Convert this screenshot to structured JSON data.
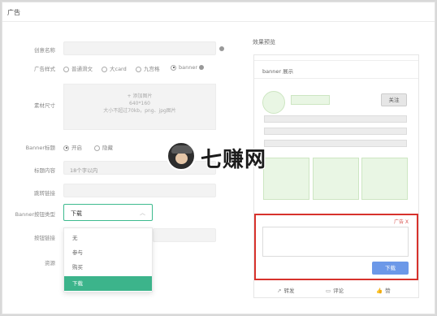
{
  "window": {
    "title": "广告"
  },
  "form": {
    "creative_name_label": "创意名称",
    "ad_style_label": "广告样式",
    "ad_style_options": [
      "普通滑文",
      "大card",
      "九宫格",
      "banner"
    ],
    "ad_style_selected": "banner",
    "material_size_label": "素材尺寸",
    "upload_add": "+ 添加图片",
    "upload_size": "640*160",
    "upload_hint": "大小不超过70kb，png、jpg图片",
    "banner_title_label": "Banner标题",
    "banner_title_options": [
      "开启",
      "隐藏"
    ],
    "banner_title_selected": "开启",
    "title_content_label": "标题内容",
    "title_content_placeholder": "18个字以内",
    "jump_link_label": "跳转链接",
    "button_type_label": "Banner按钮类型",
    "button_type_value": "下载",
    "button_link_label": "按钮链接",
    "material_label": "资源",
    "dropdown_options": [
      "无",
      "参与",
      "购买",
      "下载"
    ],
    "dropdown_selected": "下载"
  },
  "preview": {
    "title": "效果预览",
    "tab_label": "banner 展示",
    "follow_label": "关注",
    "ad_tag": "广告 X",
    "download_label": "下载",
    "actions": [
      {
        "icon": "share-icon",
        "label": "转发"
      },
      {
        "icon": "comment-icon",
        "label": "评论"
      },
      {
        "icon": "like-icon",
        "label": "赞"
      }
    ]
  },
  "watermark": {
    "text": "七赚网"
  },
  "colors": {
    "accent_green": "#3cb48b",
    "highlight_red": "#d7322c",
    "button_blue": "#6c98e8"
  }
}
